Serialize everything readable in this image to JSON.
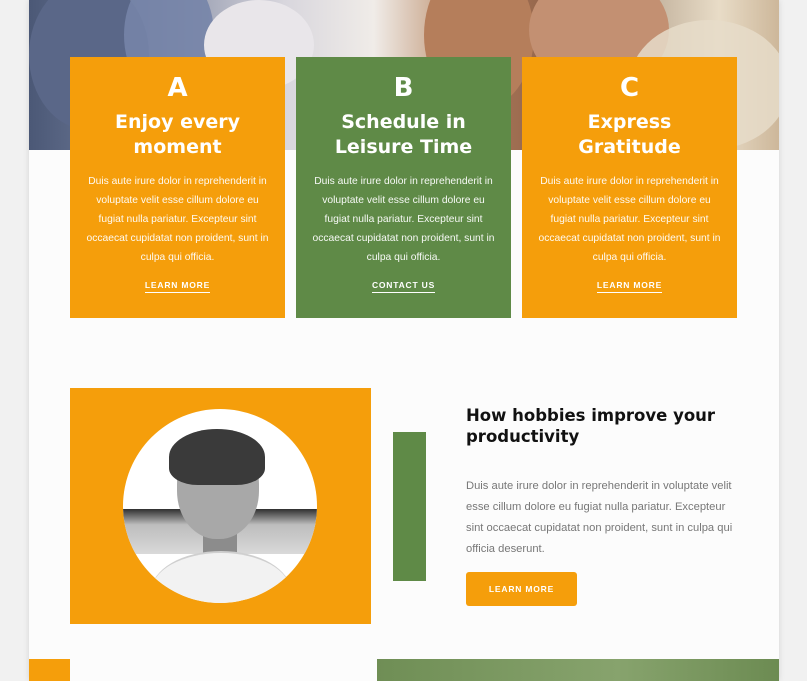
{
  "cards": [
    {
      "letter": "A",
      "title": "Enjoy every moment",
      "text": "Duis aute irure dolor in reprehenderit in voluptate velit esse cillum dolore eu fugiat nulla pariatur. Excepteur sint occaecat cupidatat non proident, sunt in culpa qui officia.",
      "link": "LEARN MORE",
      "color": "#f59e0b"
    },
    {
      "letter": "B",
      "title": "Schedule in Leisure Time",
      "text": "Duis aute irure dolor in reprehenderit in voluptate velit esse cillum dolore eu fugiat nulla pariatur. Excepteur sint occaecat cupidatat non proident, sunt in culpa qui officia.",
      "link": "CONTACT US",
      "color": "#5f8a47"
    },
    {
      "letter": "C",
      "title": "Express Gratitude",
      "text": "Duis aute irure dolor in reprehenderit in voluptate velit esse cillum dolore eu fugiat nulla pariatur. Excepteur sint occaecat cupidatat non proident, sunt in culpa qui officia.",
      "link": "LEARN MORE",
      "color": "#f59e0b"
    }
  ],
  "feature": {
    "headline": "How hobbies improve your productivity",
    "paragraph": "Duis aute irure dolor in reprehenderit in voluptate velit esse cillum dolore eu fugiat nulla pariatur. Excepteur sint occaecat cupidatat non proident, sunt in culpa qui officia deserunt.",
    "button_label": "LEARN MORE"
  },
  "colors": {
    "orange": "#f59e0b",
    "green": "#5f8a47"
  }
}
